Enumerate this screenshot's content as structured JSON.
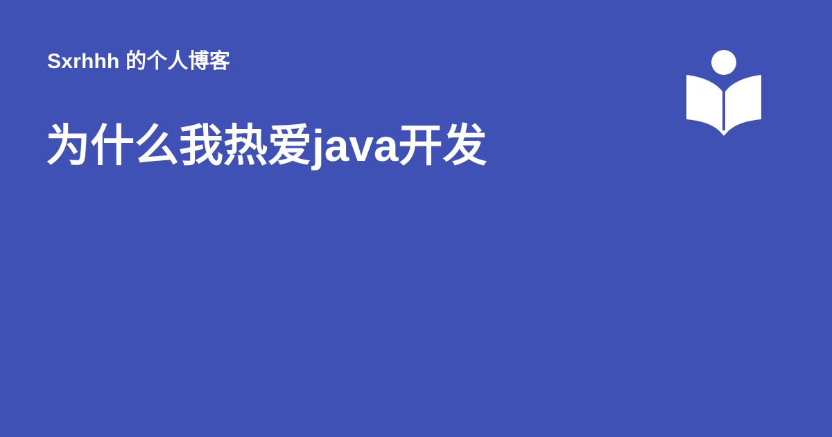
{
  "site": {
    "name": "Sxrhhh 的个人博客"
  },
  "page": {
    "title": "为什么我热爱java开发"
  },
  "logo": {
    "icon": "book-reader-icon",
    "color": "#ffffff"
  },
  "colors": {
    "background": "#3f51b5",
    "foreground": "#ffffff"
  }
}
